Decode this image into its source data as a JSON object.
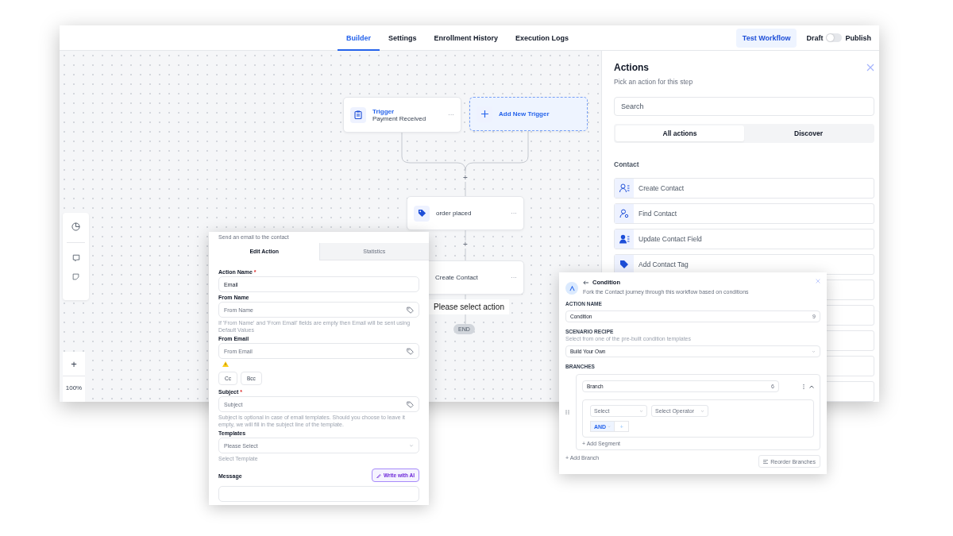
{
  "nav": {
    "tabs": [
      {
        "label": "Builder",
        "selected": true
      },
      {
        "label": "Settings",
        "selected": false
      },
      {
        "label": "Enrollment History",
        "selected": false
      },
      {
        "label": "Execution Logs",
        "selected": false
      }
    ],
    "test_button": "Test Workflow",
    "draft_label": "Draft",
    "publish_toggle": {
      "on": false
    },
    "publish_label": "Publish"
  },
  "canvas": {
    "nodes": [
      {
        "kind": "trigger",
        "title": "Trigger",
        "subtitle": "Payment Received",
        "menu": "···"
      },
      {
        "kind": "add",
        "title": "Add New Trigger"
      },
      {
        "kind": "tag",
        "title": "order placed",
        "menu": "···"
      },
      {
        "kind": "plain",
        "title": "Create Contact",
        "menu": "···"
      }
    ],
    "add_markers": [
      "+",
      "+"
    ],
    "hint": "Please select action",
    "end": "END",
    "zoom": {
      "plus": "+",
      "level": "100%"
    }
  },
  "actions_panel": {
    "title": "Actions",
    "subtitle": "Pick an action for this step",
    "search": {
      "placeholder": "Search"
    },
    "tabs": [
      {
        "label": "All actions",
        "selected": true
      },
      {
        "label": "Discover",
        "selected": false
      }
    ],
    "section": "Contact",
    "items": [
      {
        "kind": "create",
        "label": "Create Contact"
      },
      {
        "kind": "find",
        "label": "Find Contact"
      },
      {
        "kind": "update",
        "label": "Update Contact Field"
      },
      {
        "kind": "tag",
        "label": "Add Contact Tag"
      }
    ]
  },
  "email_card": {
    "subtitle": "Send an email to the contact",
    "tabs": [
      {
        "label": "Edit Action",
        "selected": true
      },
      {
        "label": "Statistics",
        "selected": false
      }
    ],
    "rows": [
      {
        "kind": "field",
        "label": "Action Name",
        "required_mark": "*",
        "value": "Email"
      },
      {
        "kind": "field",
        "label": "From Name",
        "placeholder": "From Name",
        "tag_icon": true,
        "hint": "If 'From Name' and 'From Email' fields are empty then Email will be sent using Default Values"
      },
      {
        "kind": "field",
        "label": "From Email",
        "placeholder": "From Email",
        "tag_icon": true,
        "warning": true
      },
      {
        "kind": "buttons",
        "buttons": [
          "Cc",
          "Bcc"
        ]
      },
      {
        "kind": "field",
        "label": "Subject",
        "required_mark": "*",
        "placeholder": "Subject",
        "tag_icon": true,
        "hint": "Subject is optional in case of email templates. Should you choose to leave it empty, we will fill in the subject line of the template."
      },
      {
        "kind": "select",
        "label": "Templates",
        "placeholder": "Please Select",
        "hint": "Select Template"
      },
      {
        "kind": "message",
        "label": "Message",
        "button": "Write with AI"
      }
    ]
  },
  "condition_card": {
    "title": "Condition",
    "subtitle": "Fork the Contact journey through this workflow based on conditions",
    "action_name_label": "ACTION NAME",
    "action_name": {
      "value": "Condition",
      "counter": "9"
    },
    "recipe_label": "SCENARIO RECIPE",
    "recipe_hint": "Select from one of the pre-built condition templates",
    "recipe": "Build Your Own",
    "branches_label": "BRANCHES",
    "branch": {
      "value": "Branch",
      "counter": "6"
    },
    "selects": [
      "Select",
      "Select Operator"
    ],
    "and_button": "AND",
    "plus_button": "+",
    "add_segment": "+ Add Segment",
    "add_branch": "+ Add Branch",
    "reorder": "Reorder Branches"
  }
}
